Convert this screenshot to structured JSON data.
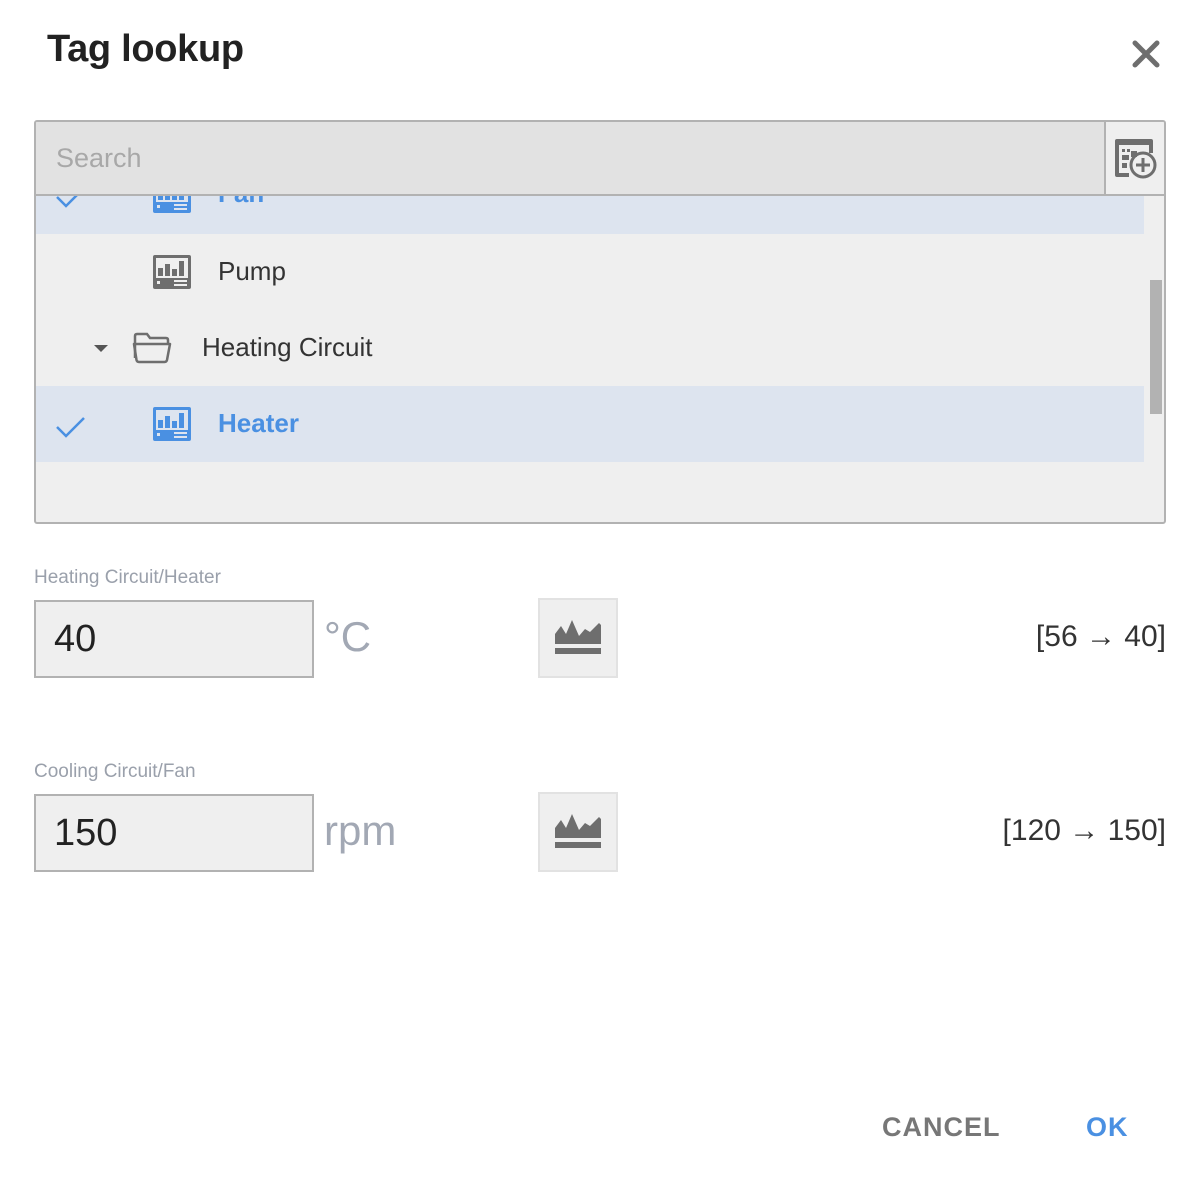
{
  "dialog": {
    "title": "Tag lookup",
    "close_icon": "close-icon"
  },
  "search": {
    "placeholder": "Search",
    "value": "",
    "add_tag_icon": "add-tag-icon"
  },
  "tree": {
    "items": [
      {
        "label": "Fan",
        "type": "tag",
        "selected": true,
        "icon": "device-chart-icon"
      },
      {
        "label": "Pump",
        "type": "tag",
        "selected": false,
        "icon": "device-chart-icon"
      },
      {
        "label": "Heating Circuit",
        "type": "folder",
        "expanded": true,
        "icon": "folder-open-icon"
      },
      {
        "label": "Heater",
        "type": "tag",
        "selected": true,
        "icon": "device-chart-icon"
      }
    ],
    "scroll_position_percent": 30
  },
  "fields": [
    {
      "label": "Heating Circuit/Heater",
      "value": "40",
      "unit": "°C",
      "range": "[56 → 40]",
      "trend_icon": "trend-chart-icon"
    },
    {
      "label": "Cooling Circuit/Fan",
      "value": "150",
      "unit": "rpm",
      "range": "[120 → 150]",
      "trend_icon": "trend-chart-icon"
    }
  ],
  "footer": {
    "cancel_label": "CANCEL",
    "ok_label": "OK"
  },
  "colors": {
    "accent": "#4a90e2",
    "selected_row": "#dde4ef",
    "panel_bg": "#efefef",
    "border": "#b2b2b2"
  }
}
